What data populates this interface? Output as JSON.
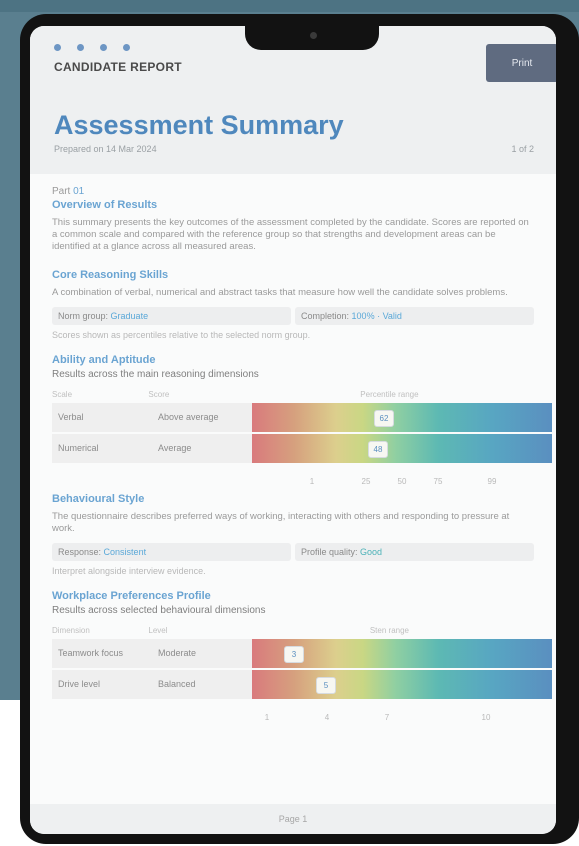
{
  "header": {
    "kicker": "CANDIDATE REPORT",
    "button_label": "Print",
    "title": "Assessment Summary",
    "meta": "Prepared on 14 Mar 2024",
    "meta_right": "1 of 2"
  },
  "overview": {
    "kicker": "Part",
    "kicker_accent": "01",
    "title": "Overview of Results",
    "paragraph": "This summary presents the key outcomes of the assessment completed by the candidate. Scores are reported on a common scale and compared with the reference group so that strengths and development areas can be identified at a glance across all measured areas."
  },
  "section_a": {
    "title": "Core Reasoning Skills",
    "paragraph": "A combination of verbal, numerical and abstract tasks that measure how well the candidate solves problems.",
    "field1_label": "Norm group:",
    "field1_value": "Graduate",
    "field2_label": "Completion:",
    "field2_value": "100% · Valid",
    "note": "Scores shown as percentiles relative to the selected norm group."
  },
  "section_b": {
    "title": "Ability and Aptitude",
    "subtitle": "Results across the main reasoning dimensions",
    "col1": "Scale",
    "col2": "Score",
    "col3": "Percentile range",
    "rows": [
      {
        "scale": "Verbal",
        "score": "Above average",
        "marker": "62"
      },
      {
        "scale": "Numerical",
        "score": "Average",
        "marker": "48"
      }
    ],
    "ticks": [
      "1",
      "25",
      "50",
      "75",
      "99"
    ]
  },
  "section_c": {
    "title": "Behavioural Style",
    "paragraph": "The questionnaire describes preferred ways of working, interacting with others and responding to pressure at work.",
    "field1_label": "Response:",
    "field1_value": "Consistent",
    "field2_label": "Profile quality:",
    "field2_value": "Good",
    "note": "Interpret alongside interview evidence."
  },
  "section_d": {
    "title": "Workplace Preferences Profile",
    "subtitle": "Results across selected behavioural dimensions",
    "col1": "Dimension",
    "col2": "Level",
    "col3": "Sten range",
    "rows": [
      {
        "scale": "Teamwork focus",
        "score": "Moderate",
        "marker": "3"
      },
      {
        "scale": "Drive level",
        "score": "Balanced",
        "marker": "5"
      }
    ],
    "ticks": [
      "1",
      "4",
      "7",
      "10"
    ]
  },
  "footer": {
    "text": "Page 1"
  },
  "colors": {
    "accent": "#4f88bd",
    "link": "#6aa4d2",
    "teal": "#4cb2b8",
    "background": "#5a7f8f"
  }
}
